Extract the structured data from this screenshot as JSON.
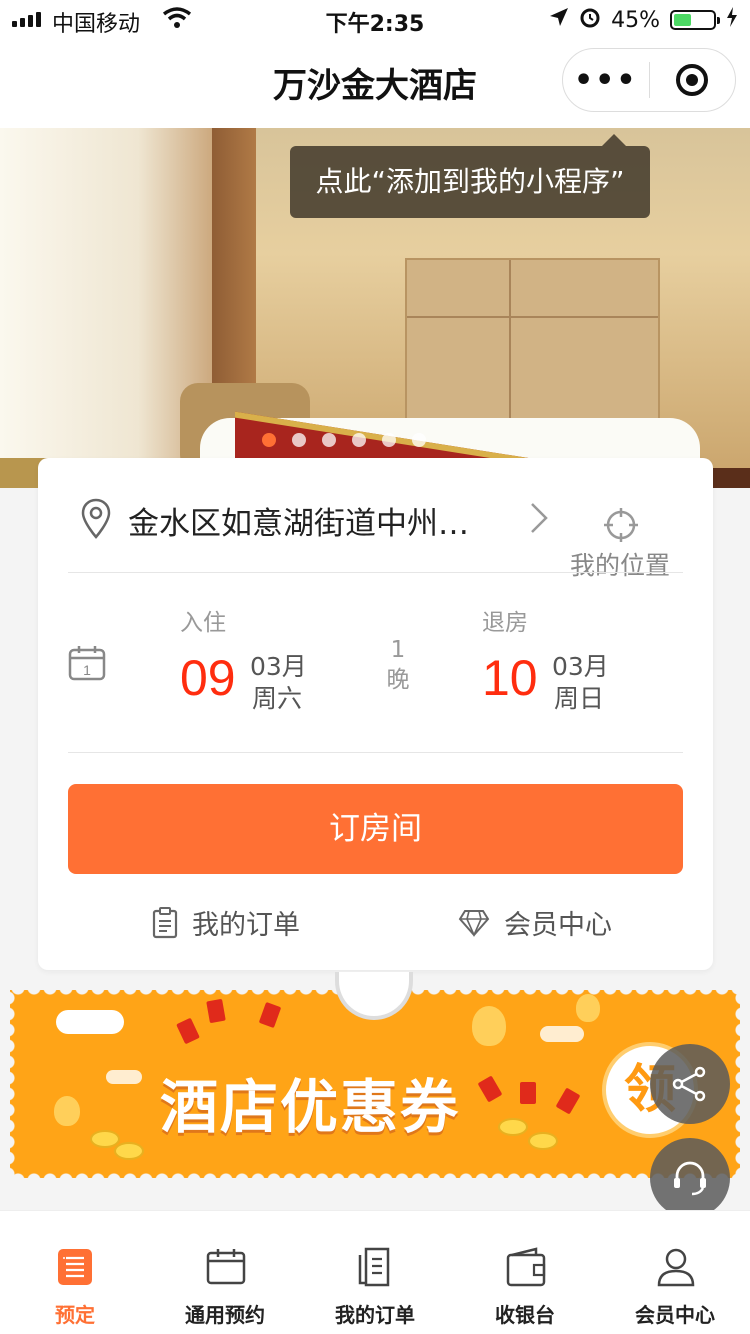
{
  "status_bar": {
    "carrier": "中国移动",
    "time": "下午2:35",
    "battery": "45%",
    "battery_level": 0.45
  },
  "nav": {
    "title": "万沙金大酒店"
  },
  "banner": {
    "tooltip": "点此“添加到我的小程序”",
    "slides_count": 6,
    "active_slide": 1
  },
  "booking": {
    "location": "金水区如意湖街道中州…",
    "my_location_label": "我的位置",
    "checkin": {
      "label": "入住",
      "day": "09",
      "month": "03月",
      "weekday": "周六"
    },
    "nights": {
      "count": "1",
      "unit": "晚"
    },
    "checkout": {
      "label": "退房",
      "day": "10",
      "month": "03月",
      "weekday": "周日"
    },
    "book_button": "订房间",
    "my_orders": "我的订单",
    "member_center": "会员中心"
  },
  "coupon": {
    "title": "酒店优惠券",
    "badge": "领"
  },
  "tabs": [
    {
      "label": "预定",
      "icon": "list-icon",
      "active": true
    },
    {
      "label": "通用预约",
      "icon": "calendar-icon",
      "active": false
    },
    {
      "label": "我的订单",
      "icon": "document-icon",
      "active": false
    },
    {
      "label": "收银台",
      "icon": "wallet-icon",
      "active": false
    },
    {
      "label": "会员中心",
      "icon": "user-icon",
      "active": false
    }
  ],
  "colors": {
    "accent": "#ff7034",
    "date_red": "#ff2d0f",
    "coupon_orange": "#ffa417"
  }
}
